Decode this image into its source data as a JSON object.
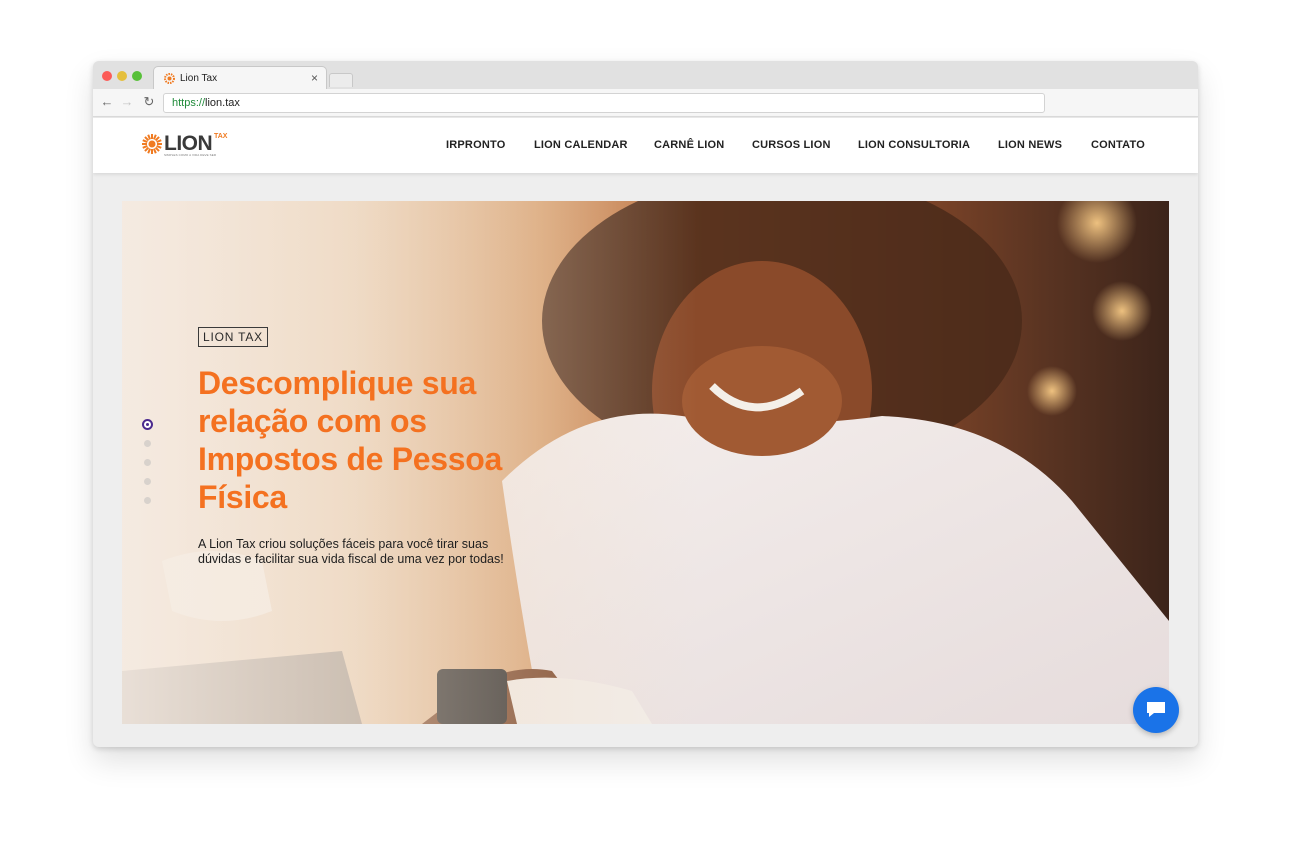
{
  "browser": {
    "tab_title": "Lion Tax",
    "tab_close": "×",
    "url_scheme": "https://",
    "url_host": "lion.tax",
    "icons": {
      "back": "arrow-left-icon",
      "forward": "arrow-right-icon",
      "reload": "reload-icon"
    }
  },
  "site": {
    "logo": {
      "word": "LION",
      "tax": "TAX",
      "tagline": "SIMPLES COMO A VIDA DEVE SER"
    },
    "menu": [
      "IRPRONTO",
      "LION CALENDAR",
      "CARNÊ LION",
      "CURSOS LION",
      "LION CONSULTORIA",
      "LION NEWS",
      "CONTATO"
    ]
  },
  "hero": {
    "tag": "LION TAX",
    "title": "Descomplique sua relação com os Impostos de Pessoa Física",
    "description": "A Lion Tax criou soluções fáceis para você tirar suas dúvidas e facilitar sua vida fiscal de uma vez por todas!",
    "slides_count": 5,
    "active_slide": 1
  },
  "colors": {
    "accent": "#f47120",
    "dot_active": "#4b2a8e",
    "chat": "#1a73e8"
  }
}
